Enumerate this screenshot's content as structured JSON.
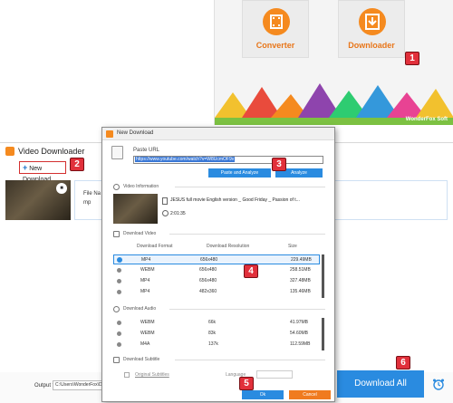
{
  "launcher": {
    "converter_label": "Converter",
    "downloader_label": "Downloader",
    "brand": "WonderFox Soft",
    "converter_icon": "film-reel-icon",
    "downloader_icon": "download-icon",
    "accent": "#f58a1f"
  },
  "callouts": [
    "1",
    "2",
    "3",
    "4",
    "5",
    "6"
  ],
  "main": {
    "title": "Video Downloader",
    "new_download": "New Download",
    "file_name_label": "File Na",
    "file_ext": "mp",
    "output_label": "Output folder:",
    "output_path": "C:\\Users\\WonderFox\\Doc",
    "download_all": "Download All"
  },
  "dialog": {
    "title": "New Download",
    "paste_url_label": "Paste URL",
    "url_value": "https://www.youtube.com/watch?v=W8UcmOF9v",
    "paste_analyze": "Paste and Analyze",
    "analyze": "Analyze",
    "video_info_label": "Video Information",
    "video_title": "JESUS full movie English version _ Good Friday _ Passion of t...",
    "duration": "2:01:35",
    "download_video_label": "Download Video",
    "video_columns": [
      "Download Format",
      "Download Resolution",
      "Size"
    ],
    "video_rows": [
      {
        "format": "MP4",
        "resolution": "656x480",
        "size": "229.49MB",
        "selected": true
      },
      {
        "format": "WEBM",
        "resolution": "656x480",
        "size": "258.51MB",
        "selected": false
      },
      {
        "format": "MP4",
        "resolution": "656x480",
        "size": "327.48MB",
        "selected": false
      },
      {
        "format": "MP4",
        "resolution": "482x360",
        "size": "135.46MB",
        "selected": false
      }
    ],
    "download_audio_label": "Download Audio",
    "audio_rows": [
      {
        "format": "WEBM",
        "bitrate": "66k",
        "size": "41.97MB"
      },
      {
        "format": "WEBM",
        "bitrate": "83k",
        "size": "54.60MB"
      },
      {
        "format": "M4A",
        "bitrate": "137k",
        "size": "112.59MB"
      }
    ],
    "download_subtitle_label": "Download Subtitle",
    "original_subtitles": "Original Subtitles",
    "language_label": "Language",
    "ok": "Ok",
    "cancel": "Cancel"
  }
}
